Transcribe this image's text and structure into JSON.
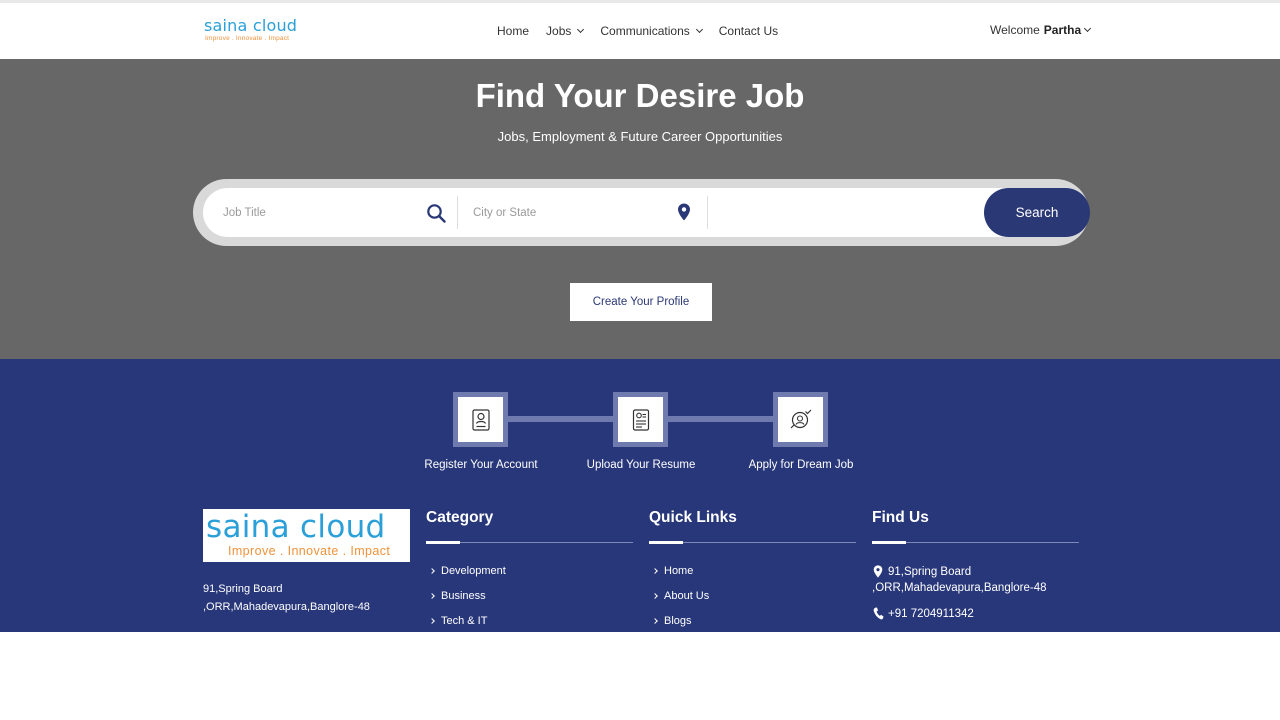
{
  "header": {
    "logo_main": "saina cloud",
    "logo_tagline": "Improve . Innovate . Impact",
    "nav": [
      {
        "label": "Home",
        "dropdown": false
      },
      {
        "label": "Jobs",
        "dropdown": true
      },
      {
        "label": "Communications",
        "dropdown": true
      },
      {
        "label": "Contact Us",
        "dropdown": false
      }
    ],
    "welcome_prefix": "Welcome",
    "user_name": "Partha"
  },
  "hero": {
    "title": "Find Your Desire Job",
    "subtitle": "Jobs, Employment & Future Career Opportunities",
    "search": {
      "job_title_placeholder": "Job Title",
      "location_placeholder": "City or State",
      "button_label": "Search"
    },
    "profile_button": "Create Your Profile"
  },
  "steps": [
    {
      "label": "Register Your Account",
      "icon": "register-icon"
    },
    {
      "label": "Upload Your Resume",
      "icon": "resume-icon"
    },
    {
      "label": "Apply for Dream Job",
      "icon": "apply-icon"
    }
  ],
  "footer": {
    "logo_main": "saina cloud",
    "logo_tagline": "Improve . Innovate . Impact",
    "address_lines": [
      "91,Spring Board",
      ",ORR,Mahadevapura,Banglore-48"
    ],
    "category": {
      "title": "Category",
      "items": [
        "Development",
        "Business",
        "Tech & IT"
      ]
    },
    "quick_links": {
      "title": "Quick Links",
      "items": [
        "Home",
        "About Us",
        "Blogs"
      ]
    },
    "find_us": {
      "title": "Find Us",
      "address_lines": [
        "91,Spring Board",
        ",ORR,Mahadevapura,Banglore-48"
      ],
      "phone": "+91 7204911342"
    }
  },
  "colors": {
    "hero_bg": "#676767",
    "primary_navy": "#2a3876",
    "footer_bg": "#283779",
    "logo_blue": "#2a9fd8",
    "logo_orange": "#f0923a"
  }
}
